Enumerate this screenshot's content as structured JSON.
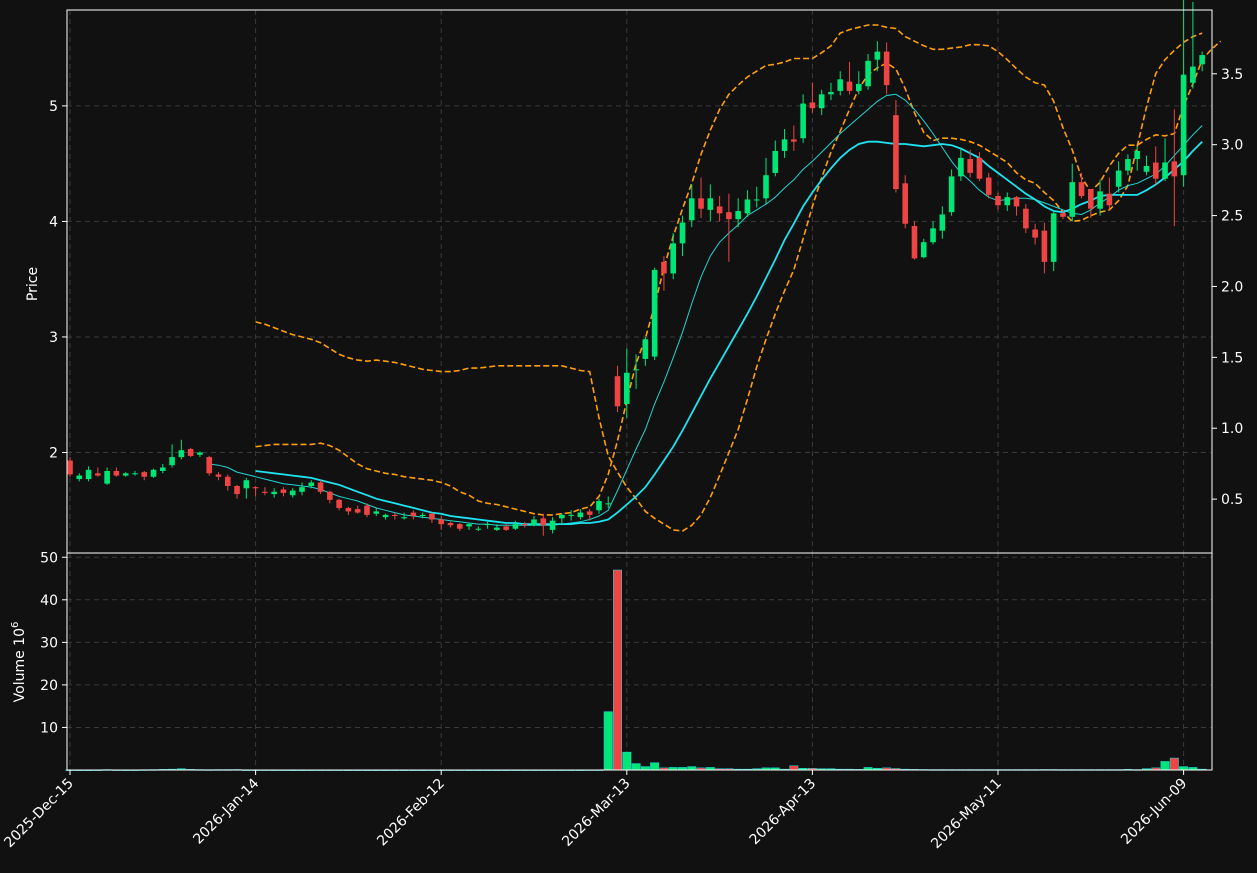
{
  "chart_data": {
    "type": "candlestick",
    "colors": {
      "background": "#111111",
      "up": "#00e676",
      "down": "#ef4444",
      "ma_fast": "#20d5d5",
      "ma_slow": "#1ee3f0",
      "bands": "#ff9f0a",
      "grid": "#3a3a3a",
      "text": "#ffffff"
    },
    "dates": [
      "2025-12-15",
      "2025-12-16",
      "2025-12-17",
      "2025-12-18",
      "2025-12-19",
      "2025-12-22",
      "2025-12-23",
      "2025-12-24",
      "2025-12-26",
      "2025-12-29",
      "2025-12-30",
      "2025-12-31",
      "2026-01-02",
      "2026-01-05",
      "2026-01-06",
      "2026-01-07",
      "2026-01-08",
      "2026-01-09",
      "2026-01-12",
      "2026-01-13",
      "2026-01-14",
      "2026-01-15",
      "2026-01-16",
      "2026-01-20",
      "2026-01-21",
      "2026-01-22",
      "2026-01-23",
      "2026-01-26",
      "2026-01-27",
      "2026-01-28",
      "2026-01-29",
      "2026-01-30",
      "2026-02-02",
      "2026-02-03",
      "2026-02-04",
      "2026-02-05",
      "2026-02-06",
      "2026-02-09",
      "2026-02-10",
      "2026-02-11",
      "2026-02-12",
      "2026-02-13",
      "2026-02-17",
      "2026-02-18",
      "2026-02-19",
      "2026-02-20",
      "2026-02-23",
      "2026-02-24",
      "2026-02-25",
      "2026-02-26",
      "2026-02-27",
      "2026-03-02",
      "2026-03-03",
      "2026-03-04",
      "2026-03-05",
      "2026-03-06",
      "2026-03-09",
      "2026-03-10",
      "2026-03-11",
      "2026-03-12",
      "2026-03-13",
      "2026-03-16",
      "2026-03-17",
      "2026-03-18",
      "2026-03-19",
      "2026-03-20",
      "2026-03-23",
      "2026-03-24",
      "2026-03-25",
      "2026-03-26",
      "2026-03-27",
      "2026-03-30",
      "2026-03-31",
      "2026-04-01",
      "2026-04-02",
      "2026-04-06",
      "2026-04-07",
      "2026-04-08",
      "2026-04-09",
      "2026-04-10",
      "2026-04-13",
      "2026-04-14",
      "2026-04-15",
      "2026-04-16",
      "2026-04-17",
      "2026-04-20",
      "2026-04-21",
      "2026-04-22",
      "2026-04-23",
      "2026-04-24",
      "2026-04-27",
      "2026-04-28",
      "2026-04-29",
      "2026-04-30",
      "2026-05-01",
      "2026-05-04",
      "2026-05-05",
      "2026-05-06",
      "2026-05-07",
      "2026-05-08",
      "2026-05-11",
      "2026-05-12",
      "2026-05-13",
      "2026-05-14",
      "2026-05-15",
      "2026-05-18",
      "2026-05-19",
      "2026-05-20",
      "2026-05-21",
      "2026-05-22",
      "2026-05-26",
      "2026-05-27",
      "2026-05-28",
      "2026-05-29",
      "2026-06-01",
      "2026-06-02",
      "2026-06-03",
      "2026-06-04",
      "2026-06-05",
      "2026-06-08",
      "2026-06-09",
      "2026-06-10",
      "2026-06-11"
    ],
    "open": [
      1.93,
      1.77,
      1.77,
      1.82,
      1.73,
      1.84,
      1.8,
      1.82,
      1.83,
      1.79,
      1.84,
      1.89,
      1.96,
      2.03,
      1.98,
      1.96,
      1.81,
      1.79,
      1.71,
      1.69,
      1.7,
      1.66,
      1.64,
      1.68,
      1.63,
      1.66,
      1.71,
      1.74,
      1.66,
      1.59,
      1.52,
      1.51,
      1.54,
      1.47,
      1.44,
      1.46,
      1.43,
      1.48,
      1.45,
      1.47,
      1.42,
      1.39,
      1.38,
      1.36,
      1.34,
      1.38,
      1.33,
      1.36,
      1.34,
      1.38,
      1.37,
      1.43,
      1.33,
      1.43,
      1.46,
      1.44,
      1.49,
      1.5,
      1.56,
      2.66,
      2.42,
      2.72,
      2.81,
      2.83,
      3.65,
      3.55,
      3.81,
      4.01,
      4.2,
      4.1,
      4.13,
      4.08,
      4.02,
      4.07,
      4.19,
      4.2,
      4.42,
      4.61,
      4.71,
      4.72,
      5.03,
      4.98,
      5.1,
      5.13,
      5.21,
      5.13,
      5.17,
      5.4,
      5.47,
      4.92,
      4.33,
      3.96,
      3.69,
      3.82,
      3.92,
      4.08,
      4.39,
      4.54,
      4.55,
      4.38,
      4.22,
      4.14,
      4.21,
      4.11,
      3.93,
      3.92,
      3.65,
      4.07,
      4.04,
      4.34,
      4.28,
      4.11,
      4.24,
      4.3,
      4.44,
      4.54,
      4.43,
      4.51,
      4.37,
      4.52,
      4.4,
      5.2,
      5.36
    ],
    "close": [
      1.81,
      1.8,
      1.85,
      1.8,
      1.84,
      1.8,
      1.82,
      1.82,
      1.79,
      1.85,
      1.87,
      1.96,
      2.02,
      1.97,
      2.0,
      1.82,
      1.79,
      1.71,
      1.64,
      1.76,
      1.69,
      1.65,
      1.66,
      1.65,
      1.67,
      1.7,
      1.74,
      1.66,
      1.59,
      1.52,
      1.49,
      1.48,
      1.46,
      1.49,
      1.46,
      1.45,
      1.44,
      1.45,
      1.46,
      1.42,
      1.38,
      1.37,
      1.34,
      1.38,
      1.34,
      1.38,
      1.35,
      1.33,
      1.38,
      1.37,
      1.42,
      1.37,
      1.41,
      1.46,
      1.46,
      1.48,
      1.46,
      1.58,
      1.56,
      2.4,
      2.69,
      2.72,
      2.98,
      3.58,
      3.55,
      3.81,
      3.99,
      4.2,
      4.11,
      4.2,
      4.07,
      4.02,
      4.09,
      4.19,
      4.19,
      4.4,
      4.61,
      4.71,
      4.69,
      5.02,
      4.98,
      5.1,
      5.12,
      5.23,
      5.13,
      5.19,
      5.39,
      5.47,
      5.18,
      4.28,
      3.98,
      3.68,
      3.82,
      3.94,
      4.06,
      4.39,
      4.55,
      4.42,
      4.37,
      4.23,
      4.14,
      4.21,
      4.13,
      3.94,
      3.86,
      3.65,
      4.07,
      4.04,
      4.34,
      4.22,
      4.11,
      4.26,
      4.14,
      4.44,
      4.54,
      4.61,
      4.48,
      4.37,
      4.51,
      4.39,
      5.27,
      5.34,
      5.44
    ],
    "high": [
      1.96,
      1.82,
      1.88,
      1.87,
      1.87,
      1.87,
      1.83,
      1.84,
      1.84,
      1.86,
      1.9,
      2.07,
      2.11,
      2.04,
      2.01,
      1.97,
      1.83,
      1.81,
      1.72,
      1.78,
      1.71,
      1.7,
      1.69,
      1.7,
      1.69,
      1.74,
      1.76,
      1.76,
      1.67,
      1.6,
      1.53,
      1.54,
      1.56,
      1.52,
      1.47,
      1.48,
      1.48,
      1.5,
      1.48,
      1.48,
      1.45,
      1.4,
      1.39,
      1.39,
      1.36,
      1.4,
      1.38,
      1.38,
      1.41,
      1.4,
      1.45,
      1.47,
      1.44,
      1.47,
      1.5,
      1.51,
      1.51,
      1.6,
      1.62,
      2.75,
      2.9,
      2.85,
      3.0,
      3.6,
      3.7,
      3.9,
      4.05,
      4.32,
      4.38,
      4.32,
      4.22,
      4.24,
      4.2,
      4.27,
      4.3,
      4.55,
      4.7,
      4.8,
      4.83,
      5.1,
      5.2,
      5.14,
      5.2,
      5.3,
      5.38,
      5.3,
      5.45,
      5.56,
      5.55,
      5.05,
      4.4,
      4.0,
      3.85,
      4.0,
      4.13,
      4.45,
      4.63,
      4.62,
      4.6,
      4.42,
      4.25,
      4.25,
      4.22,
      4.15,
      3.98,
      3.99,
      4.09,
      4.1,
      4.5,
      4.42,
      4.25,
      4.36,
      4.38,
      4.52,
      4.58,
      4.65,
      4.57,
      4.65,
      4.72,
      4.97,
      5.93,
      5.9,
      5.47
    ],
    "low": [
      1.79,
      1.75,
      1.75,
      1.79,
      1.72,
      1.79,
      1.79,
      1.8,
      1.76,
      1.78,
      1.82,
      1.87,
      1.94,
      1.96,
      1.96,
      1.8,
      1.76,
      1.67,
      1.6,
      1.6,
      1.62,
      1.63,
      1.61,
      1.62,
      1.61,
      1.63,
      1.69,
      1.64,
      1.56,
      1.5,
      1.46,
      1.47,
      1.44,
      1.45,
      1.42,
      1.42,
      1.42,
      1.42,
      1.43,
      1.39,
      1.33,
      1.35,
      1.32,
      1.33,
      1.32,
      1.34,
      1.32,
      1.32,
      1.33,
      1.35,
      1.36,
      1.28,
      1.3,
      1.38,
      1.41,
      1.42,
      1.41,
      1.47,
      1.52,
      2.35,
      2.3,
      2.55,
      2.75,
      2.8,
      3.4,
      3.5,
      3.7,
      3.95,
      4.03,
      4.0,
      4.0,
      3.65,
      3.95,
      4.04,
      4.12,
      4.15,
      4.39,
      4.55,
      4.61,
      4.68,
      4.94,
      4.92,
      5.05,
      5.09,
      5.1,
      5.1,
      5.14,
      5.3,
      5.1,
      4.25,
      3.94,
      3.67,
      3.68,
      3.8,
      3.85,
      4.05,
      4.35,
      4.38,
      4.35,
      4.2,
      4.1,
      4.09,
      4.05,
      3.9,
      3.8,
      3.55,
      3.57,
      4.02,
      4.0,
      4.2,
      4.03,
      4.05,
      4.1,
      4.25,
      4.4,
      4.44,
      4.4,
      4.32,
      4.35,
      3.96,
      4.3,
      5.15,
      5.3
    ],
    "volume_millions": [
      0.05,
      0.04,
      0.04,
      0.05,
      0.1,
      0.06,
      0.05,
      0.05,
      0.08,
      0.1,
      0.15,
      0.2,
      0.3,
      0.15,
      0.1,
      0.08,
      0.1,
      0.1,
      0.12,
      0.05,
      0.05,
      0.06,
      0.05,
      0.05,
      0.04,
      0.04,
      0.05,
      0.05,
      0.05,
      0.05,
      0.04,
      0.04,
      0.04,
      0.04,
      0.04,
      0.04,
      0.04,
      0.04,
      0.04,
      0.04,
      0.05,
      0.05,
      0.05,
      0.04,
      0.04,
      0.04,
      0.04,
      0.04,
      0.05,
      0.05,
      0.05,
      0.05,
      0.05,
      0.05,
      0.05,
      0.05,
      0.06,
      0.06,
      13.7,
      47.0,
      4.2,
      1.5,
      0.8,
      1.7,
      0.5,
      0.6,
      0.6,
      0.8,
      0.5,
      0.6,
      0.3,
      0.3,
      0.2,
      0.2,
      0.3,
      0.5,
      0.5,
      0.2,
      1.0,
      0.4,
      0.4,
      0.3,
      0.3,
      0.2,
      0.2,
      0.15,
      0.6,
      0.4,
      0.5,
      0.35,
      0.2,
      0.15,
      0.12,
      0.1,
      0.1,
      0.1,
      0.1,
      0.1,
      0.1,
      0.1,
      0.1,
      0.1,
      0.1,
      0.1,
      0.1,
      0.12,
      0.12,
      0.1,
      0.1,
      0.1,
      0.1,
      0.1,
      0.1,
      0.1,
      0.15,
      0.1,
      0.3,
      0.5,
      2.0,
      2.8,
      0.8,
      0.6,
      0.2
    ],
    "ma_fast": [
      null,
      null,
      null,
      null,
      null,
      null,
      null,
      null,
      null,
      null,
      null,
      null,
      null,
      null,
      null,
      1.9,
      1.89,
      1.87,
      1.83,
      1.81,
      1.79,
      1.77,
      1.75,
      1.73,
      1.72,
      1.71,
      1.7,
      1.68,
      1.65,
      1.62,
      1.6,
      1.58,
      1.55,
      1.52,
      1.5,
      1.48,
      1.46,
      1.45,
      1.44,
      1.43,
      1.42,
      1.41,
      1.4,
      1.39,
      1.38,
      1.38,
      1.37,
      1.37,
      1.37,
      1.37,
      1.37,
      1.37,
      1.37,
      1.38,
      1.39,
      1.4,
      1.42,
      1.45,
      1.5,
      1.67,
      1.85,
      2.03,
      2.2,
      2.42,
      2.61,
      2.82,
      3.04,
      3.29,
      3.52,
      3.7,
      3.82,
      3.9,
      3.97,
      4.05,
      4.1,
      4.15,
      4.21,
      4.29,
      4.36,
      4.45,
      4.52,
      4.6,
      4.68,
      4.76,
      4.83,
      4.9,
      4.97,
      5.04,
      5.09,
      5.1,
      5.05,
      4.97,
      4.87,
      4.76,
      4.64,
      4.52,
      4.42,
      4.35,
      4.27,
      4.21,
      4.18,
      4.19,
      4.2,
      4.2,
      4.19,
      4.16,
      4.13,
      4.1,
      4.07,
      4.06,
      4.1,
      4.16,
      4.21,
      4.27,
      4.31,
      4.33,
      4.37,
      4.41,
      4.48,
      4.57,
      4.66,
      4.75,
      4.83
    ],
    "ma_slow": [
      null,
      null,
      null,
      null,
      null,
      null,
      null,
      null,
      null,
      null,
      null,
      null,
      null,
      null,
      null,
      null,
      null,
      null,
      null,
      null,
      1.84,
      1.83,
      1.82,
      1.81,
      1.8,
      1.79,
      1.78,
      1.76,
      1.74,
      1.72,
      1.69,
      1.66,
      1.63,
      1.6,
      1.58,
      1.56,
      1.54,
      1.52,
      1.5,
      1.48,
      1.47,
      1.45,
      1.44,
      1.43,
      1.42,
      1.41,
      1.4,
      1.39,
      1.39,
      1.38,
      1.38,
      1.38,
      1.38,
      1.38,
      1.38,
      1.39,
      1.39,
      1.4,
      1.42,
      1.48,
      1.55,
      1.62,
      1.7,
      1.81,
      1.93,
      2.05,
      2.19,
      2.34,
      2.49,
      2.64,
      2.78,
      2.92,
      3.06,
      3.2,
      3.35,
      3.51,
      3.67,
      3.84,
      3.98,
      4.13,
      4.25,
      4.36,
      4.46,
      4.55,
      4.62,
      4.67,
      4.69,
      4.69,
      4.68,
      4.67,
      4.67,
      4.66,
      4.65,
      4.66,
      4.67,
      4.66,
      4.63,
      4.59,
      4.55,
      4.48,
      4.42,
      4.36,
      4.3,
      4.24,
      4.19,
      4.13,
      4.09,
      4.08,
      4.11,
      4.15,
      4.18,
      4.22,
      4.23,
      4.23,
      4.23,
      4.23,
      4.27,
      4.32,
      4.38,
      4.45,
      4.52,
      4.61,
      4.69
    ],
    "band_upper": [
      null,
      null,
      null,
      null,
      null,
      null,
      null,
      null,
      null,
      null,
      null,
      null,
      null,
      null,
      null,
      null,
      null,
      null,
      null,
      null,
      3.13,
      3.11,
      3.08,
      3.05,
      3.02,
      3.0,
      2.98,
      2.95,
      2.9,
      2.85,
      2.82,
      2.8,
      2.79,
      2.8,
      2.79,
      2.78,
      2.76,
      2.74,
      2.72,
      2.71,
      2.7,
      2.7,
      2.71,
      2.73,
      2.73,
      2.74,
      2.75,
      2.75,
      2.75,
      2.75,
      2.75,
      2.75,
      2.75,
      2.75,
      2.73,
      2.71,
      2.7,
      2.3,
      1.97,
      1.83,
      1.7,
      1.6,
      1.49,
      1.43,
      1.38,
      1.33,
      1.32,
      1.37,
      1.46,
      1.61,
      1.8,
      2.0,
      2.2,
      2.46,
      2.74,
      2.98,
      3.2,
      3.4,
      3.58,
      3.85,
      4.13,
      4.38,
      4.6,
      4.78,
      4.97,
      5.15,
      5.27,
      5.33,
      5.37,
      5.32,
      5.15,
      4.94,
      4.77,
      4.7,
      4.72,
      4.72,
      4.71,
      4.69,
      4.66,
      4.61,
      4.56,
      4.51,
      4.42,
      4.36,
      4.33,
      4.25,
      4.18,
      4.08,
      4.0,
      4.01,
      4.05,
      4.08,
      4.1,
      4.18,
      4.31,
      4.65,
      4.99,
      5.28,
      5.4,
      5.48,
      5.55,
      5.6,
      5.63
    ],
    "band_lower": [
      null,
      null,
      null,
      null,
      null,
      null,
      null,
      null,
      null,
      null,
      null,
      null,
      null,
      null,
      null,
      null,
      null,
      null,
      null,
      null,
      2.05,
      2.06,
      2.07,
      2.07,
      2.07,
      2.07,
      2.07,
      2.08,
      2.06,
      2.02,
      1.96,
      1.9,
      1.86,
      1.84,
      1.82,
      1.81,
      1.79,
      1.78,
      1.77,
      1.76,
      1.74,
      1.71,
      1.66,
      1.63,
      1.58,
      1.56,
      1.55,
      1.53,
      1.51,
      1.49,
      1.47,
      1.46,
      1.46,
      1.47,
      1.48,
      1.51,
      1.53,
      1.62,
      1.81,
      2.1,
      2.45,
      2.77,
      2.99,
      3.27,
      3.6,
      3.87,
      4.11,
      4.33,
      4.58,
      4.79,
      4.97,
      5.1,
      5.18,
      5.25,
      5.3,
      5.35,
      5.36,
      5.38,
      5.41,
      5.41,
      5.41,
      5.46,
      5.52,
      5.63,
      5.66,
      5.68,
      5.7,
      5.7,
      5.68,
      5.67,
      5.6,
      5.56,
      5.52,
      5.49,
      5.49,
      5.5,
      5.51,
      5.53,
      5.53,
      5.52,
      5.47,
      5.4,
      5.32,
      5.25,
      5.2,
      5.18,
      5.04,
      4.81,
      4.62,
      4.38,
      4.26,
      4.34,
      4.48,
      4.59,
      4.66,
      4.66,
      4.71,
      4.75,
      4.74,
      4.76,
      5.0,
      5.19,
      5.4,
      5.49,
      5.56
    ],
    "xticks": [
      "2025-Dec-15",
      "2026-Jan-14",
      "2026-Feb-12",
      "2026-Mar-13",
      "2026-Apr-13",
      "2026-May-11",
      "2026-Jun-09"
    ],
    "xtick_index": [
      0,
      20,
      40,
      60,
      80,
      100,
      120
    ],
    "price_ticks": [
      "2",
      "3",
      "4",
      "5"
    ],
    "price_tick_values": [
      2,
      3,
      4,
      5
    ],
    "secondary_ticks": [
      "0.5",
      "1.0",
      "1.5",
      "2.0",
      "2.5",
      "3.0",
      "3.5"
    ],
    "secondary_tick_values": [
      0.5,
      1.0,
      1.5,
      2.0,
      2.5,
      3.0,
      3.5
    ],
    "volume_ticks": [
      "10",
      "20",
      "30",
      "40",
      "50"
    ],
    "volume_tick_values": [
      10,
      20,
      30,
      40,
      50
    ],
    "price_ylim": [
      1.13,
      5.83
    ],
    "secondary_ylim": [
      0.12,
      3.95
    ],
    "volume_ylim": [
      0,
      51
    ],
    "ylabel_price": "Price",
    "ylabel_volume": "Volume  $10^{6}$",
    "grid": true
  }
}
